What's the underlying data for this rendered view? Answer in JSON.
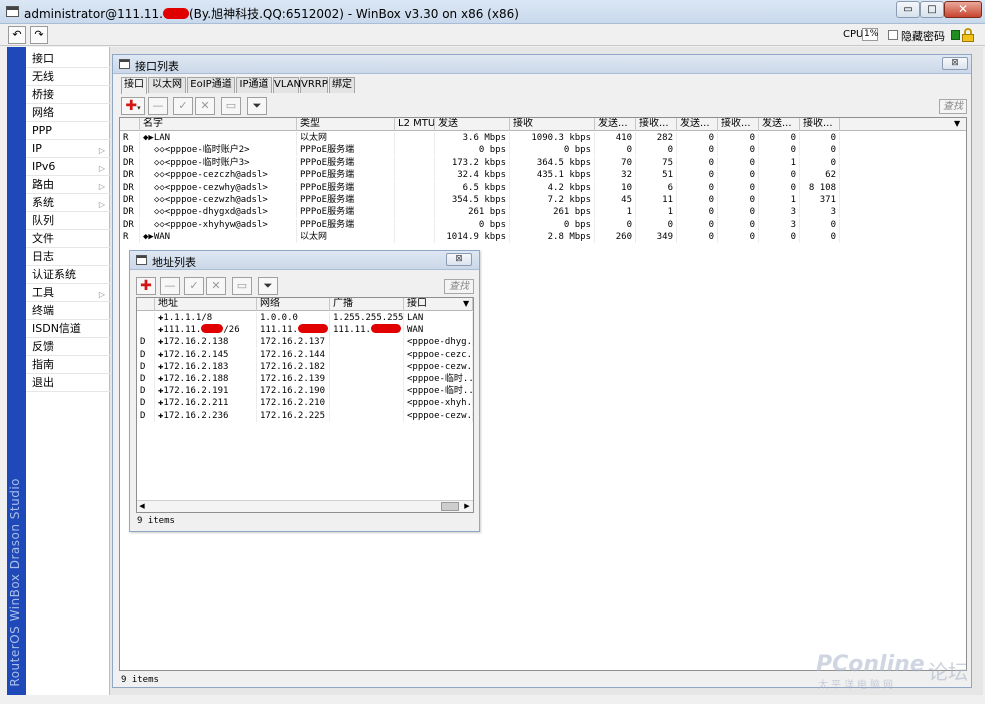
{
  "window": {
    "title_before": "administrator@111.11.",
    "title_after": "(By.旭神科技.QQ:6512002) - WinBox v3.30 on x86 (x86)",
    "min_glyph": "▭",
    "max_glyph": "□",
    "close_glyph": "✕"
  },
  "toolbar": {
    "undo_glyph": "↶",
    "redo_glyph": "↷",
    "cpu_label": "CPU:",
    "cpu_value": "1%",
    "hide_password_label": "隐藏密码"
  },
  "brand": "RouterOS WinBox  Drason Studio",
  "menu": [
    {
      "label": "接口",
      "arrow": ""
    },
    {
      "label": "无线",
      "arrow": ""
    },
    {
      "label": "桥接",
      "arrow": ""
    },
    {
      "label": "网络",
      "arrow": ""
    },
    {
      "label": "PPP",
      "arrow": ""
    },
    {
      "label": "IP",
      "arrow": "▷"
    },
    {
      "label": "IPv6",
      "arrow": "▷"
    },
    {
      "label": "路由",
      "arrow": "▷"
    },
    {
      "label": "系统",
      "arrow": "▷"
    },
    {
      "label": "队列",
      "arrow": ""
    },
    {
      "label": "文件",
      "arrow": ""
    },
    {
      "label": "日志",
      "arrow": ""
    },
    {
      "label": "认证系统",
      "arrow": ""
    },
    {
      "label": "工具",
      "arrow": "▷"
    },
    {
      "label": "终端",
      "arrow": ""
    },
    {
      "label": "ISDN信道",
      "arrow": ""
    },
    {
      "label": "反馈",
      "arrow": ""
    },
    {
      "label": "指南",
      "arrow": ""
    },
    {
      "label": "退出",
      "arrow": ""
    }
  ],
  "interface_window": {
    "title": "接口列表",
    "close_glyph": "⊠",
    "tabs": [
      "接口",
      "以太网",
      "EoIP通道",
      "IP通道",
      "VLAN",
      "VRRP",
      "绑定"
    ],
    "find_label": "查找",
    "columns": [
      "名字",
      "类型",
      "L2 MTU",
      "发送",
      "接收",
      "发送...",
      "接收...",
      "发送...",
      "接收...",
      "发送...",
      "接收..."
    ],
    "rows": [
      {
        "flag": "R",
        "name": "◆▶LAN",
        "type": "以太网",
        "mtu": "",
        "tx": "3.6 Mbps",
        "rx": "1090.3 kbps",
        "c5": "410",
        "c6": "282",
        "c7": "0",
        "c8": "0",
        "c9": "0",
        "c10": "0"
      },
      {
        "flag": "DR",
        "name": "◇◇<pppoe-临时账户2>",
        "type": "PPPoE服务端",
        "mtu": "",
        "tx": "0 bps",
        "rx": "0 bps",
        "c5": "0",
        "c6": "0",
        "c7": "0",
        "c8": "0",
        "c9": "0",
        "c10": "0"
      },
      {
        "flag": "DR",
        "name": "◇◇<pppoe-临时账户3>",
        "type": "PPPoE服务端",
        "mtu": "",
        "tx": "173.2 kbps",
        "rx": "364.5 kbps",
        "c5": "70",
        "c6": "75",
        "c7": "0",
        "c8": "0",
        "c9": "1",
        "c10": "0"
      },
      {
        "flag": "DR",
        "name": "◇◇<pppoe-cezczh@adsl>",
        "type": "PPPoE服务端",
        "mtu": "",
        "tx": "32.4 kbps",
        "rx": "435.1 kbps",
        "c5": "32",
        "c6": "51",
        "c7": "0",
        "c8": "0",
        "c9": "0",
        "c10": "62"
      },
      {
        "flag": "DR",
        "name": "◇◇<pppoe-cezwhy@adsl>",
        "type": "PPPoE服务端",
        "mtu": "",
        "tx": "6.5 kbps",
        "rx": "4.2 kbps",
        "c5": "10",
        "c6": "6",
        "c7": "0",
        "c8": "0",
        "c9": "0",
        "c10": "8 108"
      },
      {
        "flag": "DR",
        "name": "◇◇<pppoe-cezwzh@adsl>",
        "type": "PPPoE服务端",
        "mtu": "",
        "tx": "354.5 kbps",
        "rx": "7.2 kbps",
        "c5": "45",
        "c6": "11",
        "c7": "0",
        "c8": "0",
        "c9": "1",
        "c10": "371"
      },
      {
        "flag": "DR",
        "name": "◇◇<pppoe-dhygxd@adsl>",
        "type": "PPPoE服务端",
        "mtu": "",
        "tx": "261 bps",
        "rx": "261 bps",
        "c5": "1",
        "c6": "1",
        "c7": "0",
        "c8": "0",
        "c9": "3",
        "c10": "3"
      },
      {
        "flag": "DR",
        "name": "◇◇<pppoe-xhyhyw@adsl>",
        "type": "PPPoE服务端",
        "mtu": "",
        "tx": "0 bps",
        "rx": "0 bps",
        "c5": "0",
        "c6": "0",
        "c7": "0",
        "c8": "0",
        "c9": "3",
        "c10": "0"
      },
      {
        "flag": "R",
        "name": "◆▶WAN",
        "type": "以太网",
        "mtu": "",
        "tx": "1014.9 kbps",
        "rx": "2.8 Mbps",
        "c5": "260",
        "c6": "349",
        "c7": "0",
        "c8": "0",
        "c9": "0",
        "c10": "0"
      }
    ],
    "footer": "9 items"
  },
  "address_window": {
    "title": "地址列表",
    "close_glyph": "⊠",
    "find_label": "查找",
    "columns": [
      "地址",
      "网络",
      "广播",
      "接口"
    ],
    "rows": [
      {
        "flag": "",
        "address": "✚1.1.1.1/8",
        "network": "1.0.0.0",
        "broadcast": "1.255.255.255",
        "iface": "LAN"
      },
      {
        "flag": "",
        "address": "✚111.11.",
        "address_suffix": "/26",
        "network": "111.11.",
        "broadcast": "111.11.",
        "iface": "WAN",
        "redacted": true
      },
      {
        "flag": "D",
        "address": "✚172.16.2.138",
        "network": "172.16.2.137",
        "broadcast": "",
        "iface": "<pppoe-dhyg..."
      },
      {
        "flag": "D",
        "address": "✚172.16.2.145",
        "network": "172.16.2.144",
        "broadcast": "",
        "iface": "<pppoe-cezc..."
      },
      {
        "flag": "D",
        "address": "✚172.16.2.183",
        "network": "172.16.2.182",
        "broadcast": "",
        "iface": "<pppoe-cezw..."
      },
      {
        "flag": "D",
        "address": "✚172.16.2.188",
        "network": "172.16.2.139",
        "broadcast": "",
        "iface": "<pppoe-临时..."
      },
      {
        "flag": "D",
        "address": "✚172.16.2.191",
        "network": "172.16.2.190",
        "broadcast": "",
        "iface": "<pppoe-临时..."
      },
      {
        "flag": "D",
        "address": "✚172.16.2.211",
        "network": "172.16.2.210",
        "broadcast": "",
        "iface": "<pppoe-xhyh..."
      },
      {
        "flag": "D",
        "address": "✚172.16.2.236",
        "network": "172.16.2.225",
        "broadcast": "",
        "iface": "<pppoe-cezw..."
      }
    ],
    "footer": "9 items"
  },
  "watermark": {
    "main": "PConline",
    "sub": "太平洋电脑网",
    "forum": "论坛"
  },
  "colors": {
    "brand_strip": "#1f49b8",
    "add_button": "#d21616",
    "redaction": "#e00000"
  }
}
